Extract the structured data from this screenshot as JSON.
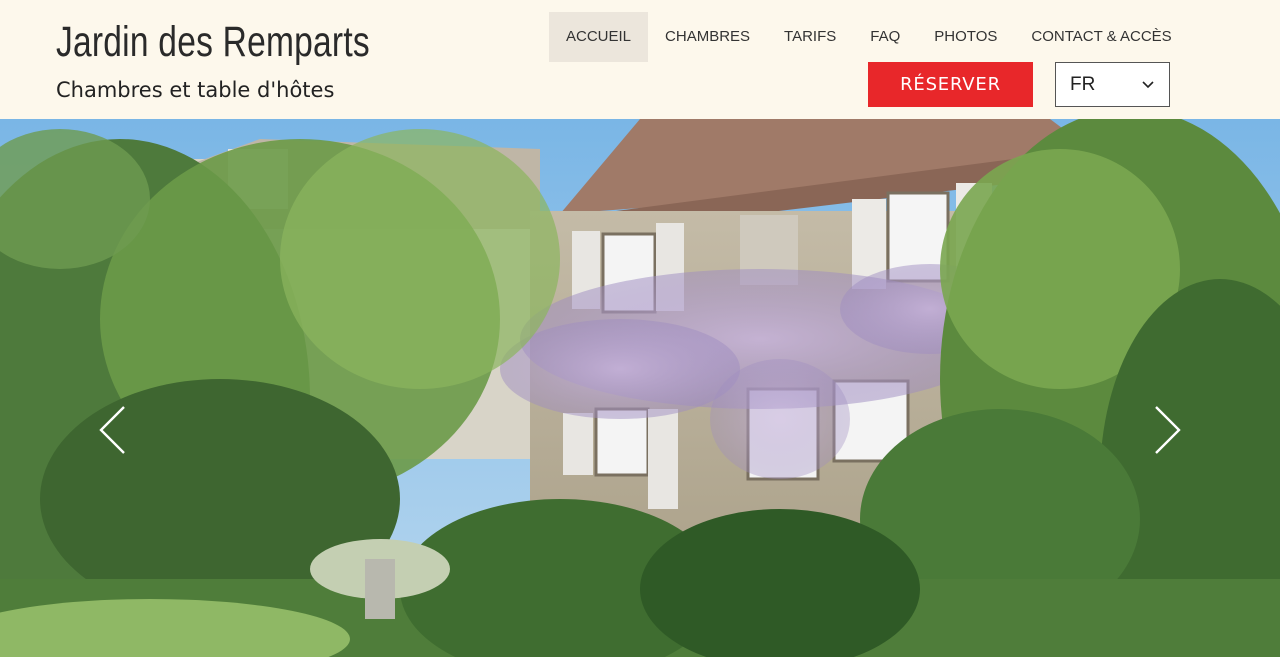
{
  "site": {
    "title": "Jardin des Remparts",
    "subtitle": "Chambres et table d'hôtes"
  },
  "nav": {
    "items": [
      {
        "label": "ACCUEIL",
        "active": true
      },
      {
        "label": "CHAMBRES",
        "active": false
      },
      {
        "label": "TARIFS",
        "active": false
      },
      {
        "label": "FAQ",
        "active": false
      },
      {
        "label": "PHOTOS",
        "active": false
      },
      {
        "label": "CONTACT & ACCÈS",
        "active": false
      }
    ]
  },
  "actions": {
    "reserve_label": "RÉSERVER",
    "language": "FR"
  },
  "hero": {
    "prev_icon": "chevron-left-icon",
    "next_icon": "chevron-right-icon"
  },
  "colors": {
    "background": "#fdf8ec",
    "accent": "#e8272a",
    "active_nav": "#ece6dc",
    "text": "#2a2a2a"
  }
}
